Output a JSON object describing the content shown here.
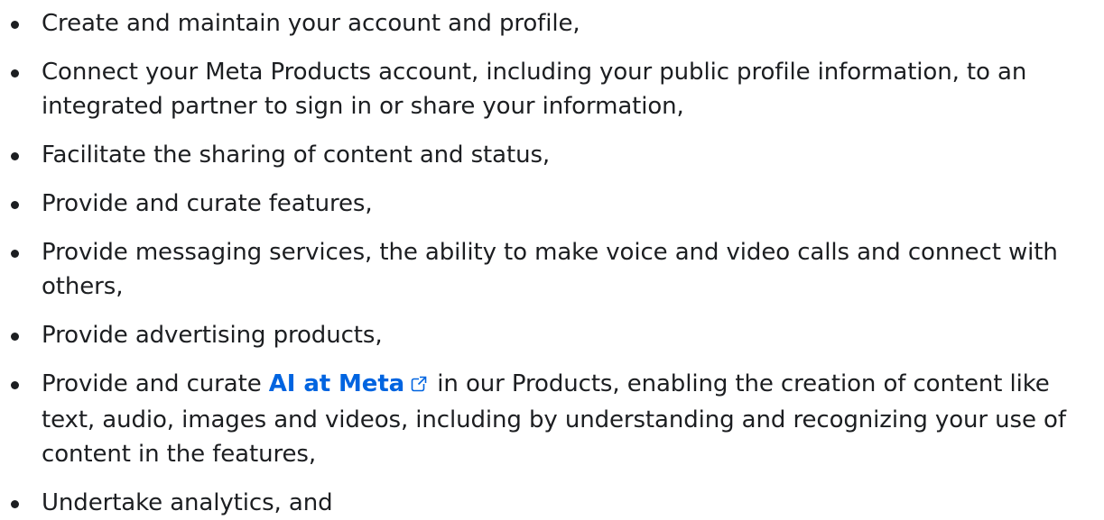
{
  "list": {
    "items": [
      {
        "text": "Create and maintain your account and profile,"
      },
      {
        "text": "Connect your Meta Products account, including your public profile information, to an integrated partner to sign in or share your information,"
      },
      {
        "text": "Facilitate the sharing of content and status,"
      },
      {
        "text": "Provide and curate features,"
      },
      {
        "text": "Provide messaging services, the ability to make voice and video calls and connect with others,"
      },
      {
        "text": "Provide advertising products,"
      },
      {
        "before": "Provide and curate ",
        "link": "AI at Meta",
        "after": " in our Products, enabling the creation of content like text, audio, images and videos, including by understanding and recognizing your use of content in the features,"
      },
      {
        "text": "Undertake analytics, and"
      }
    ],
    "link_icon": "external-link-icon",
    "colors": {
      "text": "#1c1e21",
      "link": "#0064e0"
    }
  }
}
